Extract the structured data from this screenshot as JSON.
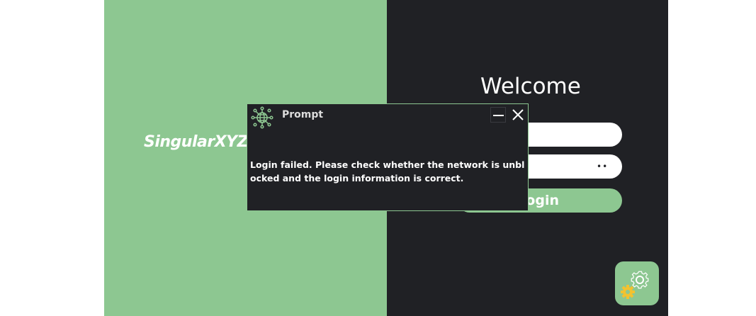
{
  "brand": {
    "logo_text": "SingularXYZ"
  },
  "login": {
    "title": "Welcome",
    "username_value": "",
    "password_value": "••",
    "login_label": "Login"
  },
  "dialog": {
    "title": "Prompt",
    "message": "Login failed. Please check whether the network is unblocked and the login information is correct."
  },
  "icons": {
    "dialog": "globe-network-icon",
    "minimize": "minimize-icon",
    "close": "close-icon",
    "settings": "gear-icon"
  },
  "colors": {
    "accent_green": "#8dc791",
    "dark_panel": "#202125",
    "gear_yellow": "#f2c230",
    "white": "#ffffff"
  }
}
